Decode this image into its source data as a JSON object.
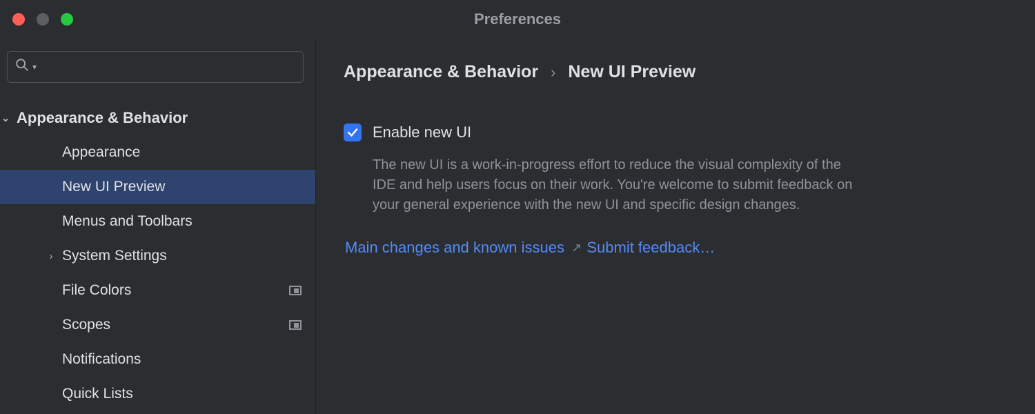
{
  "window": {
    "title": "Preferences"
  },
  "search": {
    "placeholder": ""
  },
  "sidebar": {
    "root": {
      "label": "Appearance & Behavior",
      "expanded": true
    },
    "items": [
      {
        "label": "Appearance",
        "selected": false,
        "hasArrow": false,
        "hasBadge": false
      },
      {
        "label": "New UI Preview",
        "selected": true,
        "hasArrow": false,
        "hasBadge": false
      },
      {
        "label": "Menus and Toolbars",
        "selected": false,
        "hasArrow": false,
        "hasBadge": false
      },
      {
        "label": "System Settings",
        "selected": false,
        "hasArrow": true,
        "hasBadge": false
      },
      {
        "label": "File Colors",
        "selected": false,
        "hasArrow": false,
        "hasBadge": true
      },
      {
        "label": "Scopes",
        "selected": false,
        "hasArrow": false,
        "hasBadge": true
      },
      {
        "label": "Notifications",
        "selected": false,
        "hasArrow": false,
        "hasBadge": false
      },
      {
        "label": "Quick Lists",
        "selected": false,
        "hasArrow": false,
        "hasBadge": false
      }
    ]
  },
  "breadcrumb": {
    "parent": "Appearance & Behavior",
    "current": "New UI Preview"
  },
  "content": {
    "checkbox_label": "Enable new UI",
    "checkbox_checked": true,
    "description": "The new UI is a work-in-progress effort to reduce the visual complexity of the IDE and help users focus on their work. You're welcome to submit feedback on your general experience with the new UI and specific design changes.",
    "link_changes": "Main changes and known issues",
    "link_feedback": "Submit feedback…"
  },
  "colors": {
    "accent": "#3574f0",
    "link": "#548af7",
    "bg": "#2b2d30",
    "selection": "#2e436e"
  }
}
